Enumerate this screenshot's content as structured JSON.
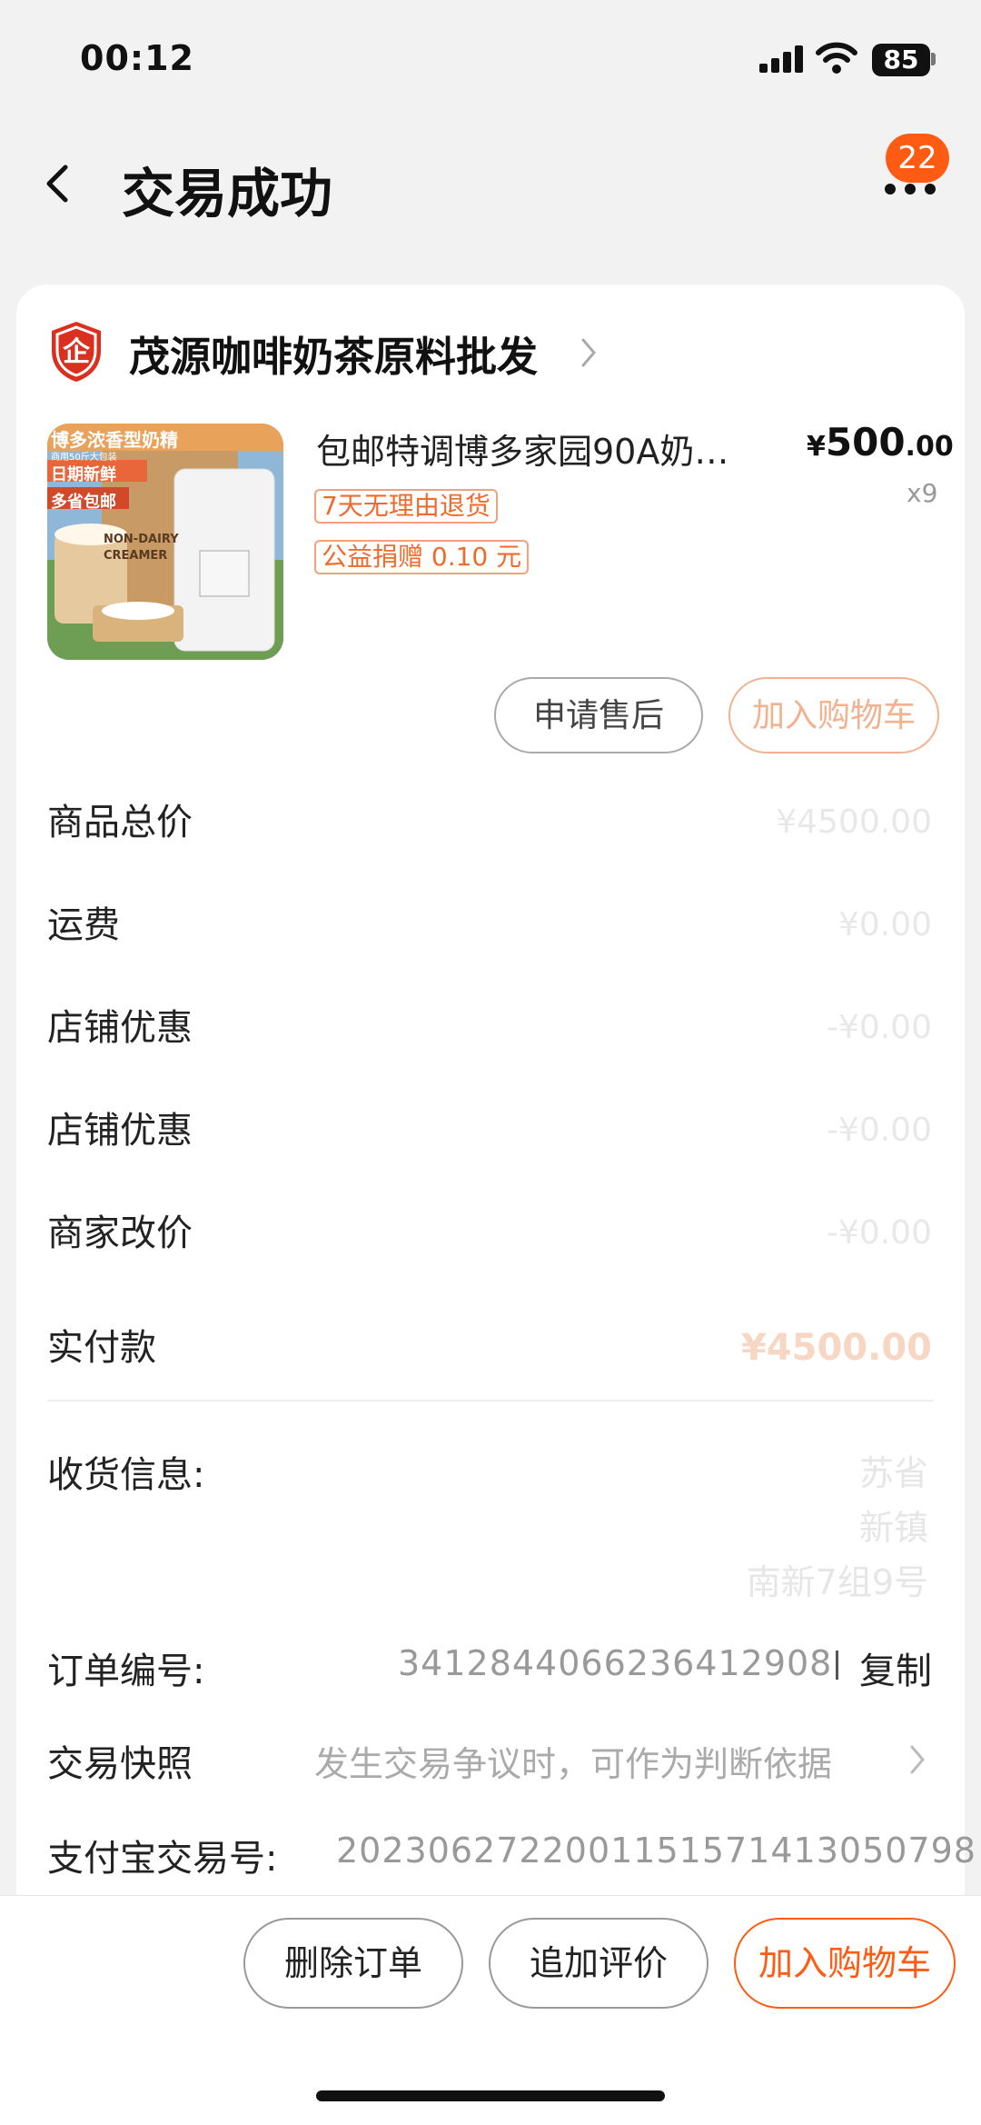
{
  "status_bar": {
    "time": "00:12",
    "battery": "85"
  },
  "header": {
    "title": "交易成功",
    "badge_count": "22"
  },
  "shop": {
    "name": "茂源咖啡奶茶原料批发",
    "logo_char": "企"
  },
  "product": {
    "title": "包邮特调博多家园90A奶…",
    "price_yen": "¥",
    "price_main": "500",
    "price_cents": ".00",
    "quantity": "x9",
    "tags": [
      "7天无理由退货",
      "公益捐赠 0.10 元"
    ],
    "image_texts": [
      "博多浓香型奶精",
      "商用50斤大包装",
      "日期新鲜",
      "多省包邮",
      "NON-DAIRY",
      "CREAMER"
    ]
  },
  "buttons": {
    "after_sale": "申请售后",
    "add_cart": "加入购物车"
  },
  "summary_rows": [
    {
      "label": "商品总价",
      "value": "¥4500.00"
    },
    {
      "label": "运费",
      "value": "¥0.00"
    },
    {
      "label": "店铺优惠",
      "value": "-¥0.00"
    },
    {
      "label": "店铺优惠",
      "value": "-¥0.00"
    },
    {
      "label": "商家改价",
      "value": "-¥0.00"
    },
    {
      "label": "实付款",
      "value": "¥4500.00"
    }
  ],
  "shipping": {
    "label": "收货信息:",
    "lines": [
      "苏省",
      "新镇",
      "南新7组9号"
    ]
  },
  "order": {
    "label": "订单编号:",
    "number": "3412844066236412908",
    "copy": "复制"
  },
  "snapshot": {
    "label": "交易快照",
    "desc": "发生交易争议时，可作为判断依据"
  },
  "alipay": {
    "label": "支付宝交易号:",
    "number": "2023062722001151571413050798"
  },
  "bottom_bar": {
    "delete": "删除订单",
    "review": "追加评价",
    "add_cart": "加入购物车"
  },
  "colors": {
    "accent": "#ff5b13",
    "background": "#f2f2f2"
  }
}
